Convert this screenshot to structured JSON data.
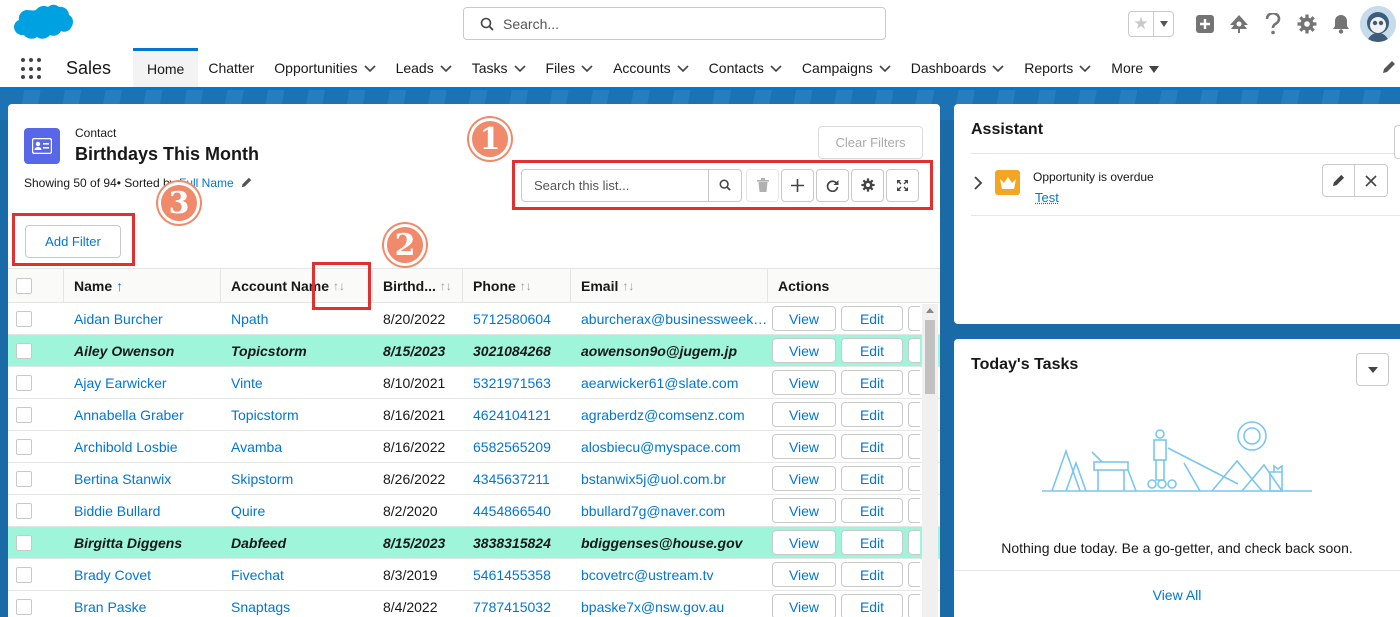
{
  "header": {
    "search_placeholder": "Search...",
    "icons": [
      "favorites-star-icon",
      "favorites-dropdown-icon",
      "global-actions-icon",
      "trailhead-icon",
      "help-icon",
      "setup-gear-icon",
      "notifications-bell-icon",
      "user-avatar"
    ]
  },
  "nav": {
    "app_name": "Sales",
    "items": [
      {
        "label": "Home",
        "active": true,
        "chevron": false
      },
      {
        "label": "Chatter",
        "active": false,
        "chevron": false
      },
      {
        "label": "Opportunities",
        "active": false,
        "chevron": true
      },
      {
        "label": "Leads",
        "active": false,
        "chevron": true
      },
      {
        "label": "Tasks",
        "active": false,
        "chevron": true
      },
      {
        "label": "Files",
        "active": false,
        "chevron": true
      },
      {
        "label": "Accounts",
        "active": false,
        "chevron": true
      },
      {
        "label": "Contacts",
        "active": false,
        "chevron": true
      },
      {
        "label": "Campaigns",
        "active": false,
        "chevron": true
      },
      {
        "label": "Dashboards",
        "active": false,
        "chevron": true
      },
      {
        "label": "Reports",
        "active": false,
        "chevron": true
      },
      {
        "label": "More",
        "active": false,
        "chevron": true
      }
    ]
  },
  "list": {
    "object_type": "Contact",
    "title": "Birthdays This Month",
    "info_prefix": "Showing 50 of 94• Sorted by",
    "info_sort_field": "Full Name",
    "clear_filters": "Clear Filters",
    "search_placeholder": "Search this list...",
    "add_filter": "Add Filter",
    "columns": [
      "Name",
      "Account Name",
      "Birthd...",
      "Phone",
      "Email",
      "Actions"
    ],
    "action_view": "View",
    "action_edit": "Edit",
    "rows": [
      {
        "name": "Aidan Burcher",
        "account": "Npath",
        "birthdate": "8/20/2022",
        "phone": "5712580604",
        "email": "aburcherax@businessweek.com",
        "highlight": false
      },
      {
        "name": "Ailey Owenson",
        "account": "Topicstorm",
        "birthdate": "8/15/2023",
        "phone": "3021084268",
        "email": "aowenson9o@jugem.jp",
        "highlight": true
      },
      {
        "name": "Ajay Earwicker",
        "account": "Vinte",
        "birthdate": "8/10/2021",
        "phone": "5321971563",
        "email": "aearwicker61@slate.com",
        "highlight": false
      },
      {
        "name": "Annabella Graber",
        "account": "Topicstorm",
        "birthdate": "8/16/2021",
        "phone": "4624104121",
        "email": "agraberdz@comsenz.com",
        "highlight": false
      },
      {
        "name": "Archibold Losbie",
        "account": "Avamba",
        "birthdate": "8/16/2022",
        "phone": "6582565209",
        "email": "alosbiecu@myspace.com",
        "highlight": false
      },
      {
        "name": "Bertina Stanwix",
        "account": "Skipstorm",
        "birthdate": "8/26/2022",
        "phone": "4345637211",
        "email": "bstanwix5j@uol.com.br",
        "highlight": false
      },
      {
        "name": "Biddie Bullard",
        "account": "Quire",
        "birthdate": "8/2/2020",
        "phone": "4454866540",
        "email": "bbullard7g@naver.com",
        "highlight": false
      },
      {
        "name": "Birgitta Diggens",
        "account": "Dabfeed",
        "birthdate": "8/15/2023",
        "phone": "3838315824",
        "email": "bdiggenses@house.gov",
        "highlight": true
      },
      {
        "name": "Brady Covet",
        "account": "Fivechat",
        "birthdate": "8/3/2019",
        "phone": "5461455358",
        "email": "bcovetrc@ustream.tv",
        "highlight": false
      },
      {
        "name": "Bran Paske",
        "account": "Snaptags",
        "birthdate": "8/4/2022",
        "phone": "7787415032",
        "email": "bpaske7x@nsw.gov.au",
        "highlight": false
      }
    ]
  },
  "annotations": {
    "badge_1": "1",
    "badge_2": "2",
    "badge_3": "3"
  },
  "assistant": {
    "title": "Assistant",
    "item_text": "Opportunity is overdue",
    "item_link": "Test"
  },
  "tasks": {
    "title": "Today's Tasks",
    "empty_message": "Nothing due today. Be a go-getter, and check back soon.",
    "view_all": "View All"
  },
  "colors": {
    "brand_blue": "#0176d3",
    "highlight_row": "#9ef5da",
    "annotation_red": "#e03030",
    "badge_orange": "#f08a6a",
    "contact_icon": "#5867e8"
  }
}
